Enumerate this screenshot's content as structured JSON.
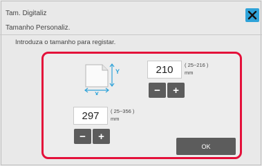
{
  "dialog": {
    "title_line1": "Tam. Digitaliz",
    "title_line2": "Tamanho Personaliz.",
    "instruction": "Introduza o tamanho para registar.",
    "close_icon": "close-x-icon",
    "close_color": "#2fa3d9"
  },
  "paper_icon": {
    "name": "paper-size-icon",
    "x_label": "X",
    "y_label": "Y",
    "accent": "#2fa3d9"
  },
  "y_dimension": {
    "value": "210",
    "range": "( 25~216 )",
    "unit": "mm",
    "minus": "−",
    "plus": "+"
  },
  "x_dimension": {
    "value": "297",
    "range": "( 25~356 )",
    "unit": "mm",
    "minus": "−",
    "plus": "+"
  },
  "ok_label": "OK",
  "highlight_color": "#e4103a"
}
